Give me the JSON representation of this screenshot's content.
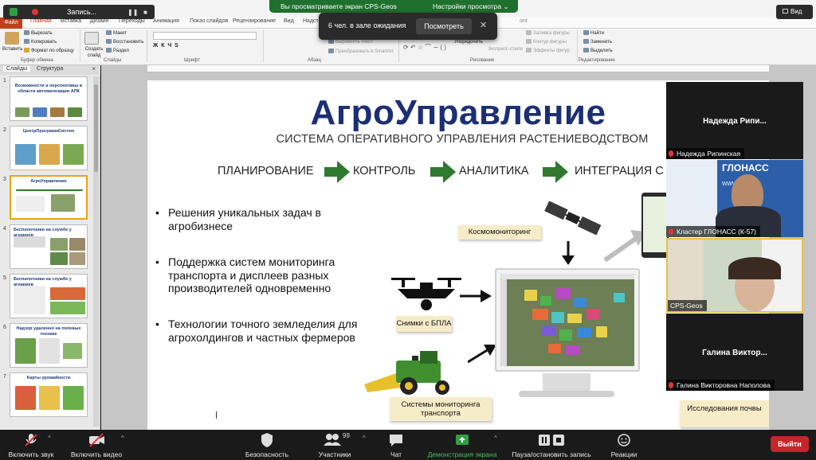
{
  "zoom": {
    "recording_label": "Запись...",
    "share_banner": "Вы просматриваете экран CPS-Geos",
    "view_options": "Настройки просмотра",
    "waiting_text": "6 чел. в зале ожидания",
    "waiting_button": "Посмотреть",
    "view_button": "Вид",
    "leave_button": "Выйти",
    "participants_count": "99",
    "toolbar": {
      "mute": "Включить звук",
      "video": "Включить видео",
      "security": "Безопасность",
      "participants": "Участники",
      "chat": "Чат",
      "share": "Демонстрация экрана",
      "record": "Пауза/остановить запись",
      "reactions": "Реакции"
    }
  },
  "ribbon": {
    "tabs": [
      "Файл",
      "Главная",
      "Вставка",
      "Дизайн",
      "Переходы",
      "Анимация",
      "Показ слайдов",
      "Рецензирование",
      "Вид",
      "Надстр"
    ],
    "active_tab": "Главная",
    "font_tab_fragment": "ont",
    "groups": [
      "Буфер обмена",
      "Слайды",
      "Шрифт",
      "Абзац",
      "Рисование",
      "Редактирование"
    ],
    "buttons": {
      "insert": "Вставить",
      "cut": "Вырезать",
      "copy": "Копировать",
      "format": "Формат по образцу",
      "new_slide": "Создать слайд",
      "layout": "Макет",
      "reset": "Восстановить",
      "section": "Раздел",
      "align_text": "Выровнять текст",
      "smartart": "Преобразовать в SmartArt",
      "arrange": "Упорядочить",
      "quick_styles": "Экспресс-стили",
      "fill": "Заливка фигуры",
      "outline": "Контур фигуры",
      "effects": "Эффекты фигур",
      "find": "Найти",
      "replace": "Заменить",
      "select": "Выделить"
    }
  },
  "pane": {
    "tab_slides": "Слайды",
    "tab_outline": "Структура",
    "close": "×",
    "thumbs": [
      {
        "num": "1",
        "title": "Возможности и перспективы в области автоматизации АПК"
      },
      {
        "num": "2",
        "title": "ЦентрПрограммСистем"
      },
      {
        "num": "3",
        "title": "АгроУправление"
      },
      {
        "num": "4",
        "title": "Беспилотники на службе у аграриев"
      },
      {
        "num": "5",
        "title": "Беспилотники на службе у аграриев"
      },
      {
        "num": "6",
        "title": "Надзор удаленно на полевых технике"
      },
      {
        "num": "7",
        "title": "Карты урожайности"
      }
    ],
    "selected": 3
  },
  "slide": {
    "title": "АгроУправление",
    "subtitle": "СИСТЕМА ОПЕРАТИВНОГО УПРАВЛЕНИЯ РАСТЕНИЕВОДСТВОМ",
    "flow": [
      "ПЛАНИРОВАНИЕ",
      "КОНТРОЛЬ",
      "АНАЛИТИКА",
      "ИНТЕГРАЦИЯ С"
    ],
    "bullets": [
      "Решения уникальных задач в агробизнесе",
      "Поддержка систем мониторинга транспорта и дисплеев разных производителей одновременно",
      "Технологии точного земледелия для агрохолдингов и частных фермеров"
    ],
    "callouts": {
      "space": "Космомониторинг",
      "drone": "Снимки с БПЛА",
      "transport": "Системы мониторинга транспорта",
      "soil": "Исследования почвы"
    },
    "accent_color": "#2f7a2f",
    "title_color": "#1b2f74"
  },
  "participants": [
    {
      "big_name": "Надежда Рипи...",
      "name": "Надежда Рипинская",
      "muted": true,
      "video": false
    },
    {
      "name": "Кластер ГЛОНАСС (К-57)",
      "muted": true,
      "video": true,
      "banner": "ГЛОНАСС",
      "banner_site": "www.....t.ru"
    },
    {
      "name": "CPS-Geos",
      "muted": false,
      "video": true,
      "active": true
    },
    {
      "big_name": "Галина Виктор...",
      "name": "Галина Викторовна Наполова",
      "muted": true,
      "video": false
    }
  ]
}
